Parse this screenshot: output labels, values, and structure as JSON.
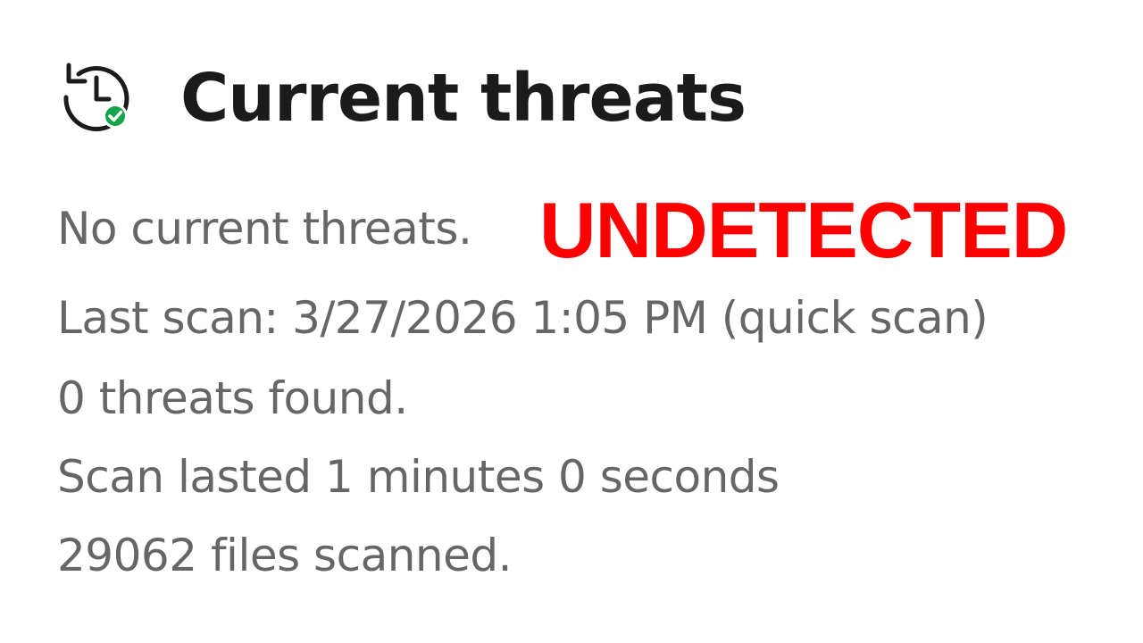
{
  "header": {
    "title": "Current threats",
    "icon": "history-check-icon",
    "icon_colors": {
      "outline": "#1b1b1b",
      "badge": "#16a34a"
    }
  },
  "status": {
    "no_threats": "No current threats.",
    "last_scan": "Last scan: 3/27/2026 1:05 PM (quick scan)",
    "threats_found": "0 threats found.",
    "scan_duration": "Scan lasted 1 minutes 0 seconds",
    "files_scanned": "29062 files scanned."
  },
  "overlay": {
    "text": "UNDETECTED",
    "color": "#ff0000"
  },
  "colors": {
    "title": "#1b1b1b",
    "body_text": "#666666",
    "background": "#ffffff"
  }
}
